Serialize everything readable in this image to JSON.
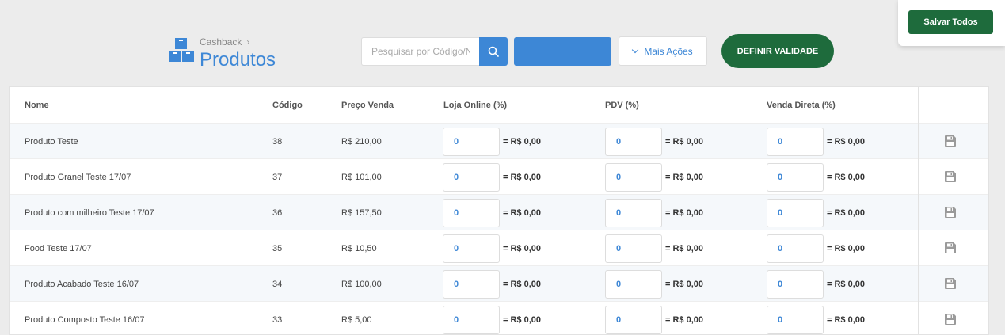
{
  "header": {
    "breadcrumb": "Cashback",
    "title": "Produtos",
    "search_placeholder": "Pesquisar por Código/Nome",
    "more_actions_label": "Mais Ações",
    "define_validity_label": "DEFINIR VALIDADE",
    "save_all_label": "Salvar Todos",
    "icon": "boxes-icon"
  },
  "colors": {
    "accent": "#3d87d6",
    "green": "#1e6b3c"
  },
  "table": {
    "columns": [
      "Nome",
      "Código",
      "Preço Venda",
      "Loja Online (%)",
      "PDV (%)",
      "Venda Direta (%)"
    ],
    "amount_prefix": "= R$ 0,00",
    "rows": [
      {
        "name": "Produto Teste",
        "code": "38",
        "price": "R$ 210,00",
        "online": "0",
        "online_amount": "= R$ 0,00",
        "pdv": "0",
        "pdv_amount": "= R$ 0,00",
        "direct": "0",
        "direct_amount": "= R$ 0,00"
      },
      {
        "name": "Produto Granel Teste 17/07",
        "code": "37",
        "price": "R$ 101,00",
        "online": "0",
        "online_amount": "= R$ 0,00",
        "pdv": "0",
        "pdv_amount": "= R$ 0,00",
        "direct": "0",
        "direct_amount": "= R$ 0,00"
      },
      {
        "name": "Produto com milheiro Teste 17/07",
        "code": "36",
        "price": "R$ 157,50",
        "online": "0",
        "online_amount": "= R$ 0,00",
        "pdv": "0",
        "pdv_amount": "= R$ 0,00",
        "direct": "0",
        "direct_amount": "= R$ 0,00"
      },
      {
        "name": "Food Teste 17/07",
        "code": "35",
        "price": "R$ 10,50",
        "online": "0",
        "online_amount": "= R$ 0,00",
        "pdv": "0",
        "pdv_amount": "= R$ 0,00",
        "direct": "0",
        "direct_amount": "= R$ 0,00"
      },
      {
        "name": "Produto Acabado Teste 16/07",
        "code": "34",
        "price": "R$ 100,00",
        "online": "0",
        "online_amount": "= R$ 0,00",
        "pdv": "0",
        "pdv_amount": "= R$ 0,00",
        "direct": "0",
        "direct_amount": "= R$ 0,00"
      },
      {
        "name": "Produto Composto Teste 16/07",
        "code": "33",
        "price": "R$ 5,00",
        "online": "0",
        "online_amount": "= R$ 0,00",
        "pdv": "0",
        "pdv_amount": "= R$ 0,00",
        "direct": "0",
        "direct_amount": "= R$ 0,00"
      }
    ]
  }
}
